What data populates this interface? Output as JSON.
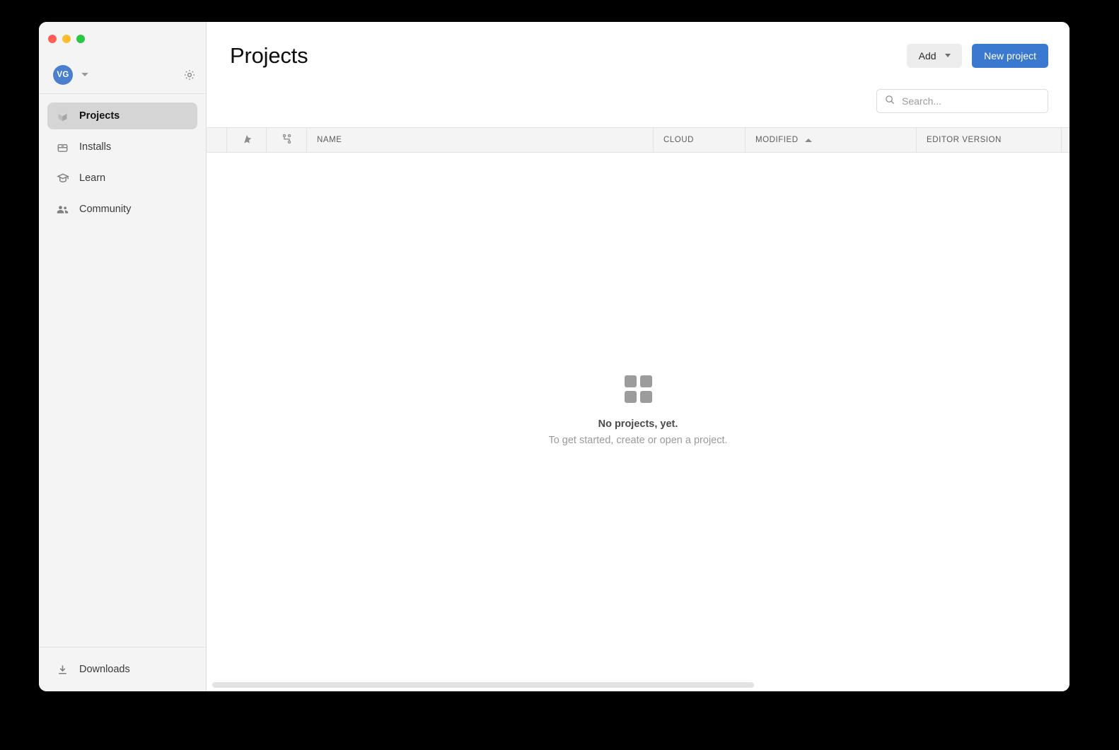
{
  "window": {
    "traffic_lights": [
      {
        "name": "close",
        "color": "#ff5f57"
      },
      {
        "name": "minimize",
        "color": "#febc2e"
      },
      {
        "name": "zoom",
        "color": "#28c840"
      }
    ]
  },
  "sidebar": {
    "account": {
      "avatar_initials": "VG",
      "avatar_color": "#4a7fd0",
      "settings_icon": "gear-icon",
      "dropdown_icon": "chevron-down-icon"
    },
    "items": [
      {
        "label": "Projects",
        "icon": "cube-icon",
        "active": true
      },
      {
        "label": "Installs",
        "icon": "download-box-icon",
        "active": false
      },
      {
        "label": "Learn",
        "icon": "graduation-cap-icon",
        "active": false
      },
      {
        "label": "Community",
        "icon": "people-icon",
        "active": false
      }
    ],
    "footer": {
      "label": "Downloads",
      "icon": "download-icon"
    }
  },
  "header": {
    "title": "Projects",
    "add_label": "Add",
    "new_project_label": "New project",
    "accent_color": "#3b78cf"
  },
  "search": {
    "placeholder": "Search...",
    "value": "",
    "icon": "search-icon"
  },
  "table": {
    "columns": [
      {
        "key": "blank",
        "label": "",
        "icon": ""
      },
      {
        "key": "favorite",
        "label": "",
        "icon": "star-icon"
      },
      {
        "key": "vcs",
        "label": "",
        "icon": "version-control-icon"
      },
      {
        "key": "name",
        "label": "NAME",
        "icon": ""
      },
      {
        "key": "cloud",
        "label": "CLOUD",
        "icon": ""
      },
      {
        "key": "modified",
        "label": "MODIFIED",
        "icon": "sort-ascending-icon",
        "sorted": "asc"
      },
      {
        "key": "editor",
        "label": "EDITOR VERSION",
        "icon": ""
      },
      {
        "key": "extra",
        "label": "",
        "icon": ""
      }
    ],
    "rows": []
  },
  "empty_state": {
    "icon": "grid-squares-icon",
    "title": "No projects, yet.",
    "subtitle": "To get started, create or open a project."
  },
  "scrollbar": {
    "orientation": "horizontal"
  }
}
